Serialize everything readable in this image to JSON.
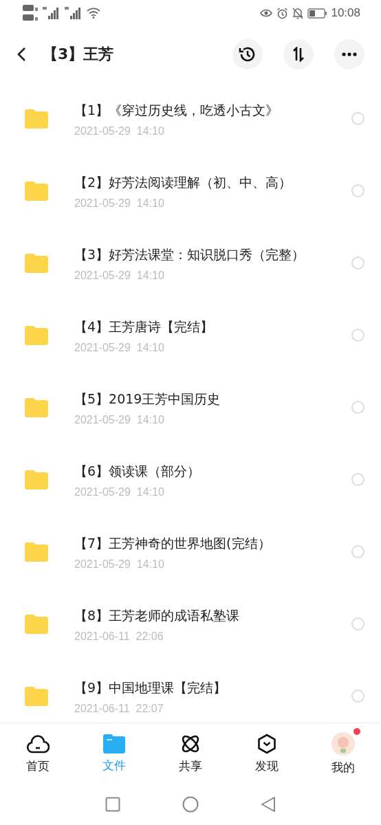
{
  "status_bar": {
    "time": "10:08"
  },
  "header": {
    "title": "【3】王芳"
  },
  "files": [
    {
      "name": "【1】《穿过历史线，吃透小古文》",
      "date": "2021-05-29  14:10",
      "checked": false
    },
    {
      "name": "【2】好芳法阅读理解（初、中、高）",
      "date": "2021-05-29  14:10",
      "checked": false
    },
    {
      "name": "【3】好芳法课堂：知识脱口秀（完整）",
      "date": "2021-05-29  14:10",
      "checked": false
    },
    {
      "name": "【4】王芳唐诗【完结】",
      "date": "2021-05-29  14:10",
      "checked": false
    },
    {
      "name": "【5】2019王芳中国历史",
      "date": "2021-05-29  14:10",
      "checked": false
    },
    {
      "name": "【6】领读课（部分）",
      "date": "2021-05-29  14:10",
      "checked": false
    },
    {
      "name": "【7】王芳神奇的世界地图(完结）",
      "date": "2021-05-29  14:10",
      "checked": false
    },
    {
      "name": "【8】王芳老师的成语私塾课",
      "date": "2021-06-11  22:06",
      "checked": false
    },
    {
      "name": "【9】中国地理课【完结】",
      "date": "2021-06-11  22:07",
      "checked": false
    }
  ],
  "tabs": [
    {
      "kind": "home",
      "label": "首页",
      "selected": false
    },
    {
      "kind": "files",
      "label": "文件",
      "selected": true
    },
    {
      "kind": "share",
      "label": "共享",
      "selected": false
    },
    {
      "kind": "discover",
      "label": "发现",
      "selected": false
    },
    {
      "kind": "me",
      "label": "我的",
      "selected": false,
      "badge": true
    }
  ]
}
